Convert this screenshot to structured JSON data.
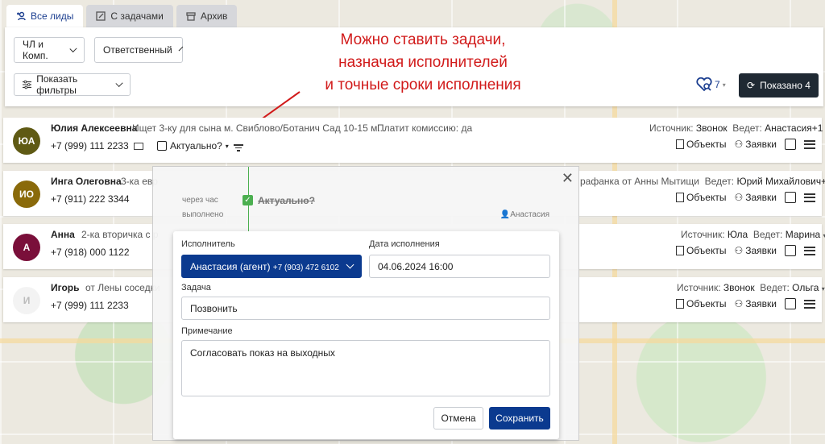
{
  "tabs": [
    {
      "label": "Все лиды",
      "icon": "add-user-icon",
      "active": true
    },
    {
      "label": "С задачами",
      "icon": "edit-icon",
      "active": false
    },
    {
      "label": "Архив",
      "icon": "archive-icon",
      "active": false
    }
  ],
  "filters": {
    "type_select": "ЧЛ и Комп.",
    "responsible_select": "Ответственный",
    "show_filters": "Показать фильтры",
    "favorites_count": "7",
    "show_button": "Показано 4"
  },
  "annotation": {
    "line1": "Можно ставить задачи,",
    "line2": "назначая исполнителей",
    "line3": "и точные сроки исполнения"
  },
  "leads": [
    {
      "initials": "ЮА",
      "avatar_color": "#5f5a14",
      "name": "Юлия Алексеевна",
      "desc": "Ищет 3-ку для сына м. Свиблово/Ботанич Сад 10-15 м...",
      "extra": "Платит комиссию: да",
      "phone": "+7 (999) 111 2233",
      "status": "Актуально?",
      "source_label": "Источник:",
      "source": "Звонок",
      "resp_label": "Ведет:",
      "resp": "Анастасия+1"
    },
    {
      "initials": "ИО",
      "avatar_color": "#8a6a0a",
      "name": "Инга Олеговна",
      "desc": "3-ка евр",
      "source_text": "рафанка от Анны Мытищи",
      "phone": "+7 (911) 222 3344",
      "resp_label": "Ведет:",
      "resp": "Юрий Михайлович+1"
    },
    {
      "initials": "А",
      "avatar_color": "#7a0f3a",
      "name": "Анна",
      "desc": "2-ка вторичка с р",
      "phone": "+7 (918) 000 1122",
      "source_label": "Источник:",
      "source": "Юла",
      "resp_label": "Ведет:",
      "resp": "Марина"
    },
    {
      "initials": "И",
      "avatar_color": "#f3f3f3",
      "name": "Игорь",
      "desc": "от Лены соседки",
      "phone": "+7 (999) 111 2233",
      "source_label": "Источник:",
      "source": "Звонок",
      "resp_label": "Ведет:",
      "resp": "Ольга"
    }
  ],
  "card_actions": {
    "objects": "Объекты",
    "requests": "Заявки"
  },
  "task_history": {
    "time": "через час",
    "state": "выполнено",
    "title": "Актуально?",
    "assignee": "Анастасия"
  },
  "task_form": {
    "executor_label": "Исполнитель",
    "executor_value": "Анастасия (агент)",
    "executor_phone": "+7 (903) 472 6102",
    "date_label": "Дата исполнения",
    "date_value": "04.06.2024 16:00",
    "task_label": "Задача",
    "task_value": "Позвонить",
    "note_label": "Примечание",
    "note_value": "Согласовать показ на выходных",
    "cancel": "Отмена",
    "save": "Сохранить"
  }
}
